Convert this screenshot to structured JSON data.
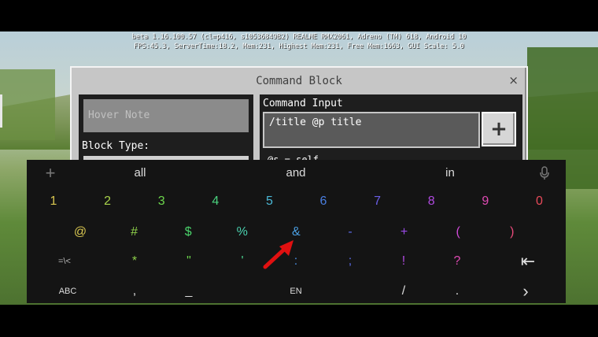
{
  "debug": {
    "line1": "beta 1.16.100.57 (cl=p416, s10536849B2) REALME RMX2061, Adreno (TM) 618, Android 10",
    "line2": "FPS:45.3, ServerTime:18.2, Mem:231, Highest Mem:231, Free Mem:1663, GUI Scale: 5.0"
  },
  "dialog": {
    "title": "Command Block",
    "close_symbol": "×",
    "hover_note_placeholder": "Hover Note",
    "block_type_label": "Block Type:",
    "command_input_label": "Command Input",
    "command_value": "/title @p title",
    "add_button_symbol": "+",
    "selector_hint": "@s = self"
  },
  "keyboard": {
    "top_bar": {
      "plus": "+",
      "suggestions": [
        "all",
        "and",
        "in"
      ],
      "mic_icon": "microphone-icon"
    },
    "digits": [
      {
        "label": "1",
        "color": "#d8c650"
      },
      {
        "label": "2",
        "color": "#a8d24a"
      },
      {
        "label": "3",
        "color": "#6cd64c"
      },
      {
        "label": "4",
        "color": "#4ad27e"
      },
      {
        "label": "5",
        "color": "#4ab8d6"
      },
      {
        "label": "6",
        "color": "#4a7ee0"
      },
      {
        "label": "7",
        "color": "#6a5ee6"
      },
      {
        "label": "8",
        "color": "#b04ae0"
      },
      {
        "label": "9",
        "color": "#e04ab4"
      },
      {
        "label": "0",
        "color": "#e84a5a"
      }
    ],
    "symbols": [
      {
        "label": "@",
        "color": "#d8c650"
      },
      {
        "label": "#",
        "color": "#8ed04a"
      },
      {
        "label": "$",
        "color": "#4ad26a"
      },
      {
        "label": "%",
        "color": "#4ad2b0"
      },
      {
        "label": "&",
        "color": "#4a9ee0"
      },
      {
        "label": "-",
        "color": "#5a6ae6"
      },
      {
        "label": "+",
        "color": "#9a4ae6"
      },
      {
        "label": "(",
        "color": "#d04ad8"
      },
      {
        "label": ")",
        "color": "#e84a7a"
      }
    ],
    "row3": {
      "toggle": "=\\<",
      "keys": [
        {
          "label": "*",
          "color": "#8ed04a"
        },
        {
          "label": "\"",
          "color": "#6cd64c"
        },
        {
          "label": "'",
          "color": "#4ad28e"
        },
        {
          "label": ":",
          "color": "#4a8ee0"
        },
        {
          "label": ";",
          "color": "#5a6ae6"
        },
        {
          "label": "!",
          "color": "#b04ae0"
        },
        {
          "label": "?",
          "color": "#e04ab4"
        }
      ],
      "backspace": "⇤"
    },
    "bottom": {
      "abc": "ABC",
      "comma": ",",
      "underscore": "_",
      "space_label": "EN",
      "slash": "/",
      "period": ".",
      "next": "›"
    }
  }
}
